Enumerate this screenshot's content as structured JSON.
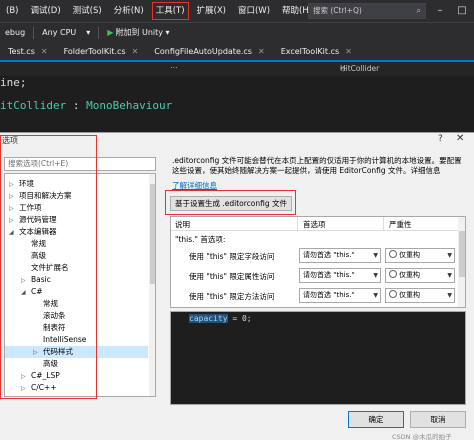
{
  "menubar": {
    "items": [
      "(B)",
      "调试(D)",
      "测试(S)",
      "分析(N)",
      "工具(T)",
      "扩展(X)",
      "窗口(W)",
      "帮助(H)"
    ],
    "search_placeholder": "搜索 (Ctrl+Q)"
  },
  "toolbar": {
    "config": "ebug",
    "platform": "Any CPU",
    "attach": "附加到 Unity"
  },
  "tabs": [
    "Test.cs",
    "FolderToolKit.cs",
    "ConfigFileAutoUpdate.cs",
    "ExcelToolKit.cs"
  ],
  "nav": {
    "path": "HitCollider"
  },
  "code": {
    "line1": "ine;",
    "line2_prefix": "itCollider",
    "line2_sep": " : ",
    "line2_base": "MonoBehaviour"
  },
  "dialog": {
    "title": "选项",
    "help": "?",
    "search_placeholder": "搜索选项(Ctrl+E)",
    "tree": [
      {
        "label": "环境",
        "level": 0,
        "exp": "▷"
      },
      {
        "label": "项目和解决方案",
        "level": 0,
        "exp": "▷"
      },
      {
        "label": "工作项",
        "level": 0,
        "exp": "▷"
      },
      {
        "label": "源代码管理",
        "level": 0,
        "exp": "▷"
      },
      {
        "label": "文本编辑器",
        "level": 0,
        "exp": "◢"
      },
      {
        "label": "常规",
        "level": 1,
        "exp": ""
      },
      {
        "label": "高级",
        "level": 1,
        "exp": ""
      },
      {
        "label": "文件扩展名",
        "level": 1,
        "exp": ""
      },
      {
        "label": "Basic",
        "level": 1,
        "exp": "▷"
      },
      {
        "label": "C#",
        "level": 1,
        "exp": "◢"
      },
      {
        "label": "常规",
        "level": 2,
        "exp": ""
      },
      {
        "label": "滚动条",
        "level": 2,
        "exp": ""
      },
      {
        "label": "制表符",
        "level": 2,
        "exp": ""
      },
      {
        "label": "IntelliSense",
        "level": 2,
        "exp": ""
      },
      {
        "label": "代码样式",
        "level": 2,
        "exp": "▷",
        "selected": true
      },
      {
        "label": "高级",
        "level": 2,
        "exp": ""
      },
      {
        "label": "C#_LSP",
        "level": 1,
        "exp": "▷"
      },
      {
        "label": "C/C++",
        "level": 1,
        "exp": "▷"
      }
    ],
    "description": ".editorconfig 文件可能会替代在本页上配置的仅适用于你的计算机的本地设置。要配置这些设置，使其始终随解决方案一起提供，请使用 EditorConfig 文件。详细信息",
    "link": "了解详细信息",
    "generate_button": "基于设置生成 .editorconfig 文件",
    "grid": {
      "headers": [
        "说明",
        "首选项",
        "严重性"
      ],
      "group": "\"this.\" 首选项:",
      "rows": [
        {
          "label": "使用 \"this\" 限定字段访问",
          "preference": "请勿首选 \"this.\"",
          "severity": "仅重构"
        },
        {
          "label": "使用 \"this\" 限定属性访问",
          "preference": "请勿首选 \"this.\"",
          "severity": "仅重构"
        },
        {
          "label": "使用 \"this\" 限定方法访问",
          "preference": "请勿首选 \"this.\"",
          "severity": "仅重构"
        }
      ]
    },
    "preview": {
      "var": "capacity",
      "rest": " = 0;"
    },
    "ok": "确定",
    "cancel": "取消"
  },
  "watermark": "CSDN @木瓜的拍子",
  "colors": {
    "accent": "#007acc",
    "highlight": "#e8322c",
    "selection": "#cce8ff"
  }
}
